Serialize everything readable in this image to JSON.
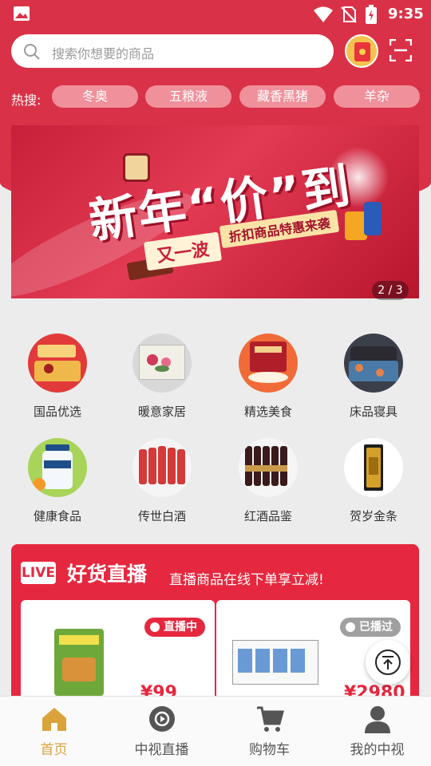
{
  "status_bar": {
    "time": "9:35"
  },
  "search": {
    "placeholder": "搜索你想要的商品"
  },
  "hot_search": {
    "label": "热搜:",
    "tags": [
      "冬奥",
      "五粮液",
      "藏香黑猪",
      "羊杂"
    ]
  },
  "banner": {
    "headline": "新年“价”到",
    "sub1": "又一波",
    "sub2": "折扣商品特惠来袭",
    "indicator": "2 / 3"
  },
  "categories": [
    {
      "label": "国品优选",
      "icon": "gift-box-icon"
    },
    {
      "label": "暖意家居",
      "icon": "peony-painting-icon"
    },
    {
      "label": "精选美食",
      "icon": "food-box-icon"
    },
    {
      "label": "床品寝具",
      "icon": "bedding-icon"
    },
    {
      "label": "健康食品",
      "icon": "health-food-icon"
    },
    {
      "label": "传世白酒",
      "icon": "liquor-bottles-icon"
    },
    {
      "label": "红酒品鉴",
      "icon": "wine-bottles-icon"
    },
    {
      "label": "贺岁金条",
      "icon": "gold-bar-icon"
    }
  ],
  "live": {
    "badge": "LIVE",
    "title": "好货直播",
    "subtitle": "直播商品在线下单享立减!",
    "products": [
      {
        "status": "直播中",
        "status_color": "#e5283f",
        "price": "¥99"
      },
      {
        "status": "已播过",
        "status_color": "#a0a0a0",
        "price": "¥2980"
      }
    ]
  },
  "bottom_nav": [
    {
      "label": "首页",
      "icon": "home-icon",
      "active": true
    },
    {
      "label": "中视直播",
      "icon": "live-play-icon",
      "active": false
    },
    {
      "label": "购物车",
      "icon": "cart-icon",
      "active": false
    },
    {
      "label": "我的中视",
      "icon": "user-icon",
      "active": false
    }
  ],
  "colors": {
    "brand_red": "#d93248",
    "active_gold": "#d9a33a"
  }
}
